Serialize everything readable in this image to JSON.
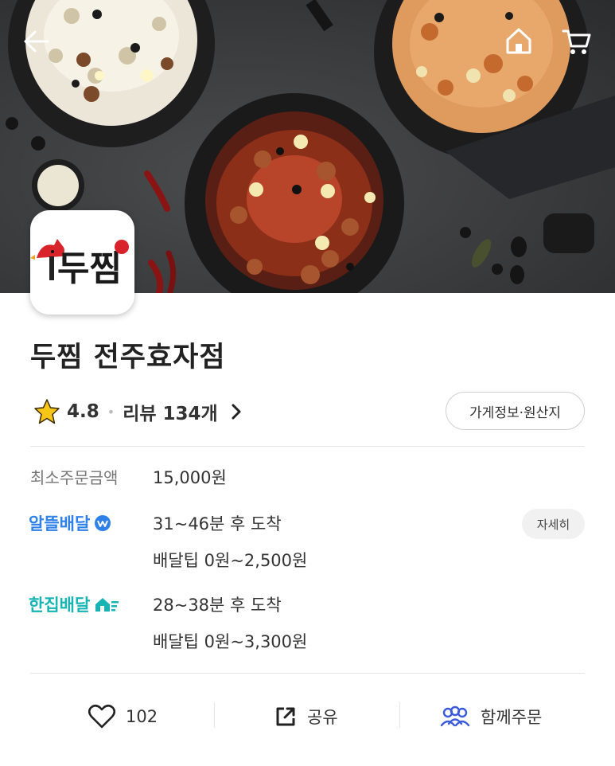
{
  "store": {
    "name": "두찜 전주효자점",
    "logo_text": "두찜",
    "rating": "4.8",
    "review_label": "리뷰 134개",
    "info_button": "가게정보·원산지"
  },
  "min_order": {
    "label": "최소주문금액",
    "value": "15,000원"
  },
  "delivery": [
    {
      "name": "알뜰배달",
      "color": "#2f80e8",
      "time": "31~46분 후 도착",
      "tip": "배달팁 0원~2,500원",
      "detail_button": "자세히"
    },
    {
      "name": "한집배달",
      "color": "#18b3b3",
      "time": "28~38분 후 도착",
      "tip": "배달팁 0원~3,300원"
    }
  ],
  "actions": {
    "like_count": "102",
    "share_label": "공유",
    "group_order_label": "함께주문"
  },
  "icons": {
    "back": "back-arrow-icon",
    "home": "home-icon",
    "cart": "cart-icon",
    "star": "star-icon",
    "like": "heart-icon",
    "share": "share-icon",
    "group": "group-icon"
  },
  "colors": {
    "star": "#f5c518",
    "brand_red": "#d8232a"
  }
}
